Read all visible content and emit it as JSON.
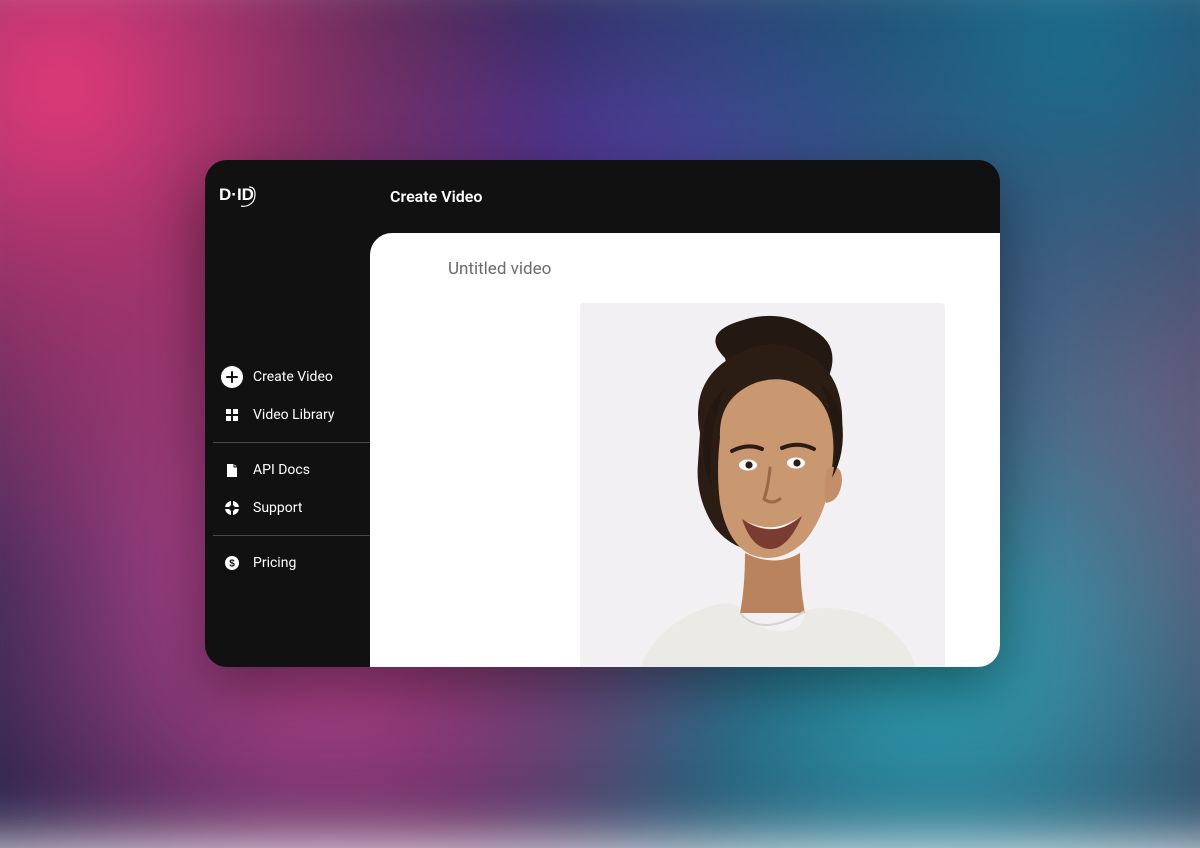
{
  "brand": {
    "logo_text": "D·ID"
  },
  "header": {
    "page_title": "Create Video"
  },
  "sidebar": {
    "items": [
      {
        "label": "Create Video",
        "icon": "plus-circle-icon"
      },
      {
        "label": "Video Library",
        "icon": "grid-icon"
      },
      {
        "label": "API Docs",
        "icon": "document-icon"
      },
      {
        "label": "Support",
        "icon": "lifebuoy-icon"
      },
      {
        "label": "Pricing",
        "icon": "dollar-circle-icon"
      }
    ]
  },
  "main": {
    "video_title": "Untitled video",
    "avatar_description": "smiling-person-portrait"
  }
}
